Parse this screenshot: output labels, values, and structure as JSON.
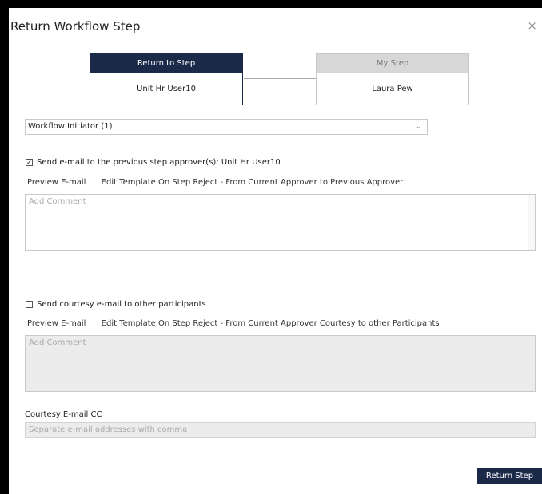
{
  "dialog": {
    "title": "Return Workflow Step",
    "close_glyph": "×"
  },
  "steps": {
    "return_to": {
      "header": "Return to Step",
      "name": "Unit Hr User10"
    },
    "my_step": {
      "header": "My Step",
      "name": "Laura Pew"
    }
  },
  "workflow_select": {
    "selected": "Workflow Initiator (1)"
  },
  "previous_approver": {
    "checked": true,
    "label": "Send e-mail to the previous step approver(s): Unit Hr User10",
    "preview_link": "Preview E-mail",
    "edit_link": "Edit Template On Step Reject - From Current Approver to Previous Approver",
    "comment_placeholder": "Add Comment"
  },
  "courtesy": {
    "checked": false,
    "label": "Send courtesy e-mail to other participants",
    "preview_link": "Preview E-mail",
    "edit_link": "Edit Template On Step Reject - From Current Approver Courtesy to other Participants",
    "comment_placeholder": "Add Comment"
  },
  "cc": {
    "label": "Courtesy E-mail CC",
    "placeholder": "Separate e-mail addresses with comma"
  },
  "actions": {
    "return_label": "Return Step"
  },
  "colors": {
    "navy": "#1c2a4a",
    "disabled_bg": "#ececec"
  },
  "icons": {
    "close": "close-icon",
    "chevron": "chevron-down-icon",
    "checkbox": "checkbox-icon"
  }
}
